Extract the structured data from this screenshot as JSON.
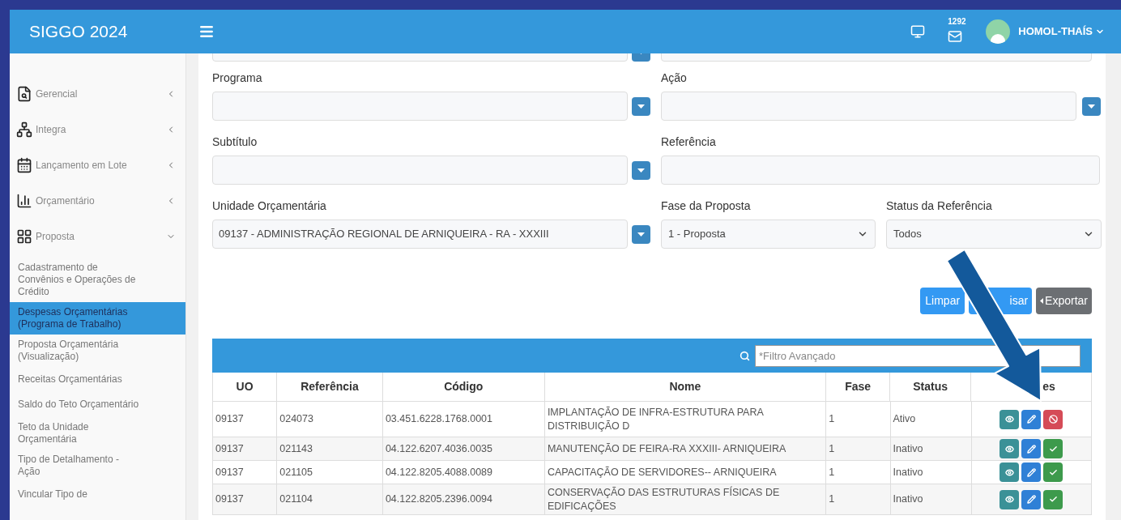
{
  "header": {
    "title": "SIGGO 2024",
    "message_count": "1292",
    "user": "HOMOL-THAÍS"
  },
  "sidebar": {
    "groups": [
      {
        "label": "Gerencial",
        "expanded": false
      },
      {
        "label": "Integra",
        "expanded": false
      },
      {
        "label": "Lançamento em Lote",
        "expanded": false
      },
      {
        "label": "Orçamentário",
        "expanded": false
      },
      {
        "label": "Proposta",
        "expanded": true
      }
    ],
    "items": [
      {
        "label": "Cadastramento de Convênios e Operações de Crédito",
        "selected": false
      },
      {
        "label": "Despesas Orçamentárias (Programa de Trabalho)",
        "selected": true
      },
      {
        "label": "Proposta Orçamentária (Visualização)",
        "selected": false
      },
      {
        "label": "Receitas Orçamentárias",
        "selected": false
      },
      {
        "label": "Saldo do Teto Orçamentário",
        "selected": false
      },
      {
        "label": "Teto da Unidade Orçamentária",
        "selected": false
      },
      {
        "label": "Tipo de Detalhamento - Ação",
        "selected": false
      },
      {
        "label": "Vincular Tipo de",
        "selected": false
      }
    ]
  },
  "form": {
    "programa": {
      "label": "Programa"
    },
    "acao": {
      "label": "Ação"
    },
    "subtitulo": {
      "label": "Subtítulo"
    },
    "referencia": {
      "label": "Referência"
    },
    "unidade": {
      "label": "Unidade Orçamentária",
      "value": "09137 - ADMINISTRAÇÃO REGIONAL DE ARNIQUEIRA - RA - XXXIII"
    },
    "fase": {
      "label": "Fase da Proposta",
      "value": "1 - Proposta"
    },
    "status": {
      "label": "Status da Referência",
      "value": "Todos"
    }
  },
  "buttons": {
    "clear": "Limpar",
    "search": "isar",
    "export": "Exportar"
  },
  "table": {
    "filter_placeholder": "*Filtro Avançado",
    "columns": [
      "UO",
      "Referência",
      "Código",
      "Nome",
      "Fase",
      "Status",
      "es"
    ],
    "rows": [
      {
        "uo": "09137",
        "referencia": "024073",
        "codigo": "03.451.6228.1768.0001",
        "nome": "IMPLANTAÇÃO DE INFRA-ESTRUTURA PARA DISTRIBUIÇÃO D",
        "fase": "1",
        "status": "Ativo",
        "actions": [
          {
            "kind": "view"
          },
          {
            "kind": "edit"
          },
          {
            "kind": "deactivate"
          }
        ]
      },
      {
        "uo": "09137",
        "referencia": "021143",
        "codigo": "04.122.6207.4036.0035",
        "nome": "MANUTENÇÃO DE FEIRA-RA XXXIII- ARNIQUEIRA",
        "fase": "1",
        "status": "Inativo",
        "actions": [
          {
            "kind": "view"
          },
          {
            "kind": "edit"
          },
          {
            "kind": "activate"
          }
        ]
      },
      {
        "uo": "09137",
        "referencia": "021105",
        "codigo": "04.122.8205.4088.0089",
        "nome": "CAPACITAÇÃO DE SERVIDORES-- ARNIQUEIRA",
        "fase": "1",
        "status": "Inativo",
        "actions": [
          {
            "kind": "view"
          },
          {
            "kind": "edit"
          },
          {
            "kind": "activate"
          }
        ]
      },
      {
        "uo": "09137",
        "referencia": "021104",
        "codigo": "04.122.8205.2396.0094",
        "nome": "CONSERVAÇÃO DAS ESTRUTURAS FÍSICAS DE EDIFICAÇÕES",
        "fase": "1",
        "status": "Inativo",
        "actions": [
          {
            "kind": "view"
          },
          {
            "kind": "edit"
          },
          {
            "kind": "activate"
          }
        ]
      }
    ]
  }
}
